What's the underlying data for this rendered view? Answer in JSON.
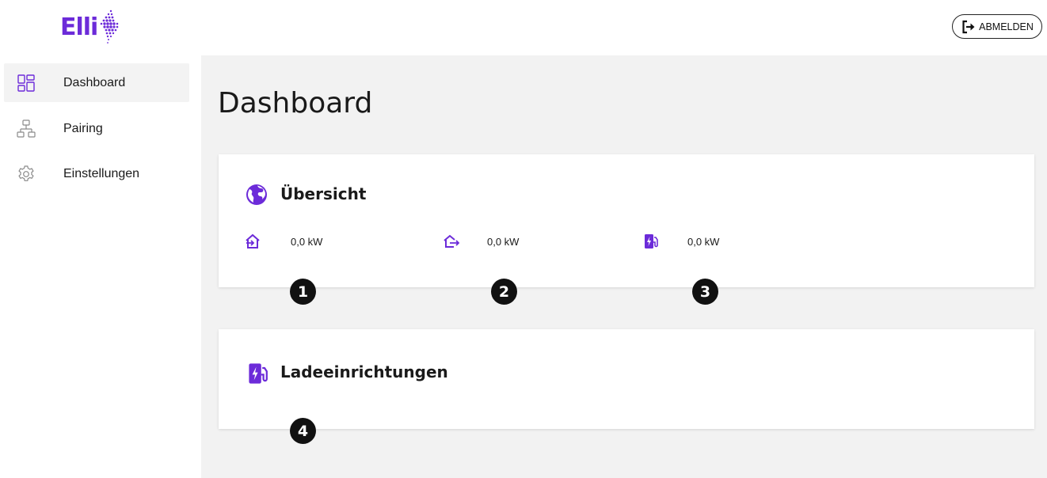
{
  "header": {
    "logo_text": "Elli",
    "logout_label": "ABMELDEN"
  },
  "sidebar": {
    "items": [
      {
        "label": "Dashboard",
        "icon": "dashboard-icon",
        "active": true
      },
      {
        "label": "Pairing",
        "icon": "network-icon",
        "active": false
      },
      {
        "label": "Einstellungen",
        "icon": "gear-icon",
        "active": false
      }
    ]
  },
  "main": {
    "title": "Dashboard",
    "overview": {
      "title": "Übersicht",
      "icon": "globe-icon",
      "metrics": [
        {
          "icon": "grid-import-icon",
          "value": "0,0 kW",
          "badge": "1"
        },
        {
          "icon": "grid-export-icon",
          "value": "0,0 kW",
          "badge": "2"
        },
        {
          "icon": "charging-station-icon",
          "value": "0,0 kW",
          "badge": "3"
        }
      ]
    },
    "chargers": {
      "title": "Ladeeinrichtungen",
      "icon": "charging-station-icon",
      "badge": "4"
    }
  },
  "colors": {
    "accent": "#6c2bd9",
    "background": "#f2f2f2"
  }
}
